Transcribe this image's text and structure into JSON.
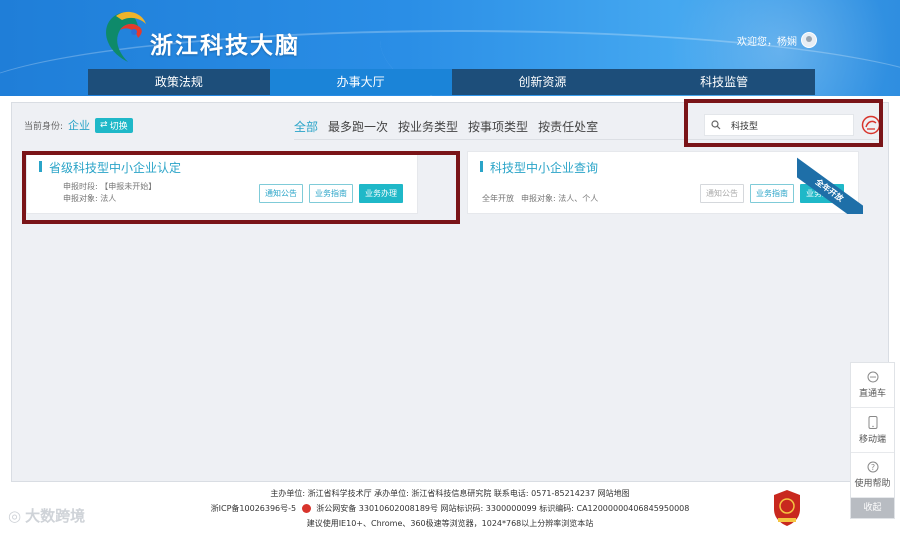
{
  "header": {
    "site_title": "浙江科技大脑",
    "welcome_text": "欢迎您，杨娴"
  },
  "nav": {
    "items": [
      {
        "label": "政策法规"
      },
      {
        "label": "办事大厅"
      },
      {
        "label": "创新资源"
      },
      {
        "label": "科技监管"
      }
    ],
    "active_index": 1
  },
  "identity": {
    "label": "当前身份:",
    "role": "企业",
    "switch_label": "切换"
  },
  "filters": {
    "items": [
      "全部",
      "最多跑一次",
      "按业务类型",
      "按事项类型",
      "按责任处室"
    ],
    "active": "全部"
  },
  "search": {
    "value": "科技型"
  },
  "cards": [
    {
      "title": "省级科技型中小企业认定",
      "meta_line1": "申报时段: 【申报未开始】",
      "meta_line2": "申报对象: 法人",
      "buttons": [
        "通知公告",
        "业务指南",
        "业务办理"
      ]
    },
    {
      "title": "科技型中小企业查询",
      "meta_line1": "全年开放",
      "meta_line2": "申报对象: 法人、个人",
      "buttons": [
        "通知公告",
        "业务指南",
        "业务办理"
      ],
      "ribbon": "全年开放"
    }
  ],
  "float_panel": {
    "items": [
      {
        "label": "直通车",
        "icon": "chat-icon"
      },
      {
        "label": "移动端",
        "icon": "phone-icon"
      },
      {
        "label": "使用帮助",
        "icon": "help-icon"
      }
    ],
    "collapse_label": "收起"
  },
  "footer": {
    "line1": "主办单位: 浙江省科学技术厅  承办单位: 浙江省科技信息研究院  联系电话: 0571-85214237  网站地图",
    "line2_icp": "浙ICP备10026396号-5",
    "line2_rest": "浙公网安备 33010602008189号  网站标识码: 3300000099  标识编码: CA12000000406845950008",
    "line3": "建议使用IE10+、Chrome、360极速等浏览器，1024*768以上分辨率浏览本站"
  },
  "watermark": {
    "text": "大数跨境"
  },
  "colors": {
    "accent": "#2aa4c8",
    "nav_bg": "#1d4e7a",
    "nav_active": "#1b84d8",
    "highlight": "#7a1418"
  }
}
